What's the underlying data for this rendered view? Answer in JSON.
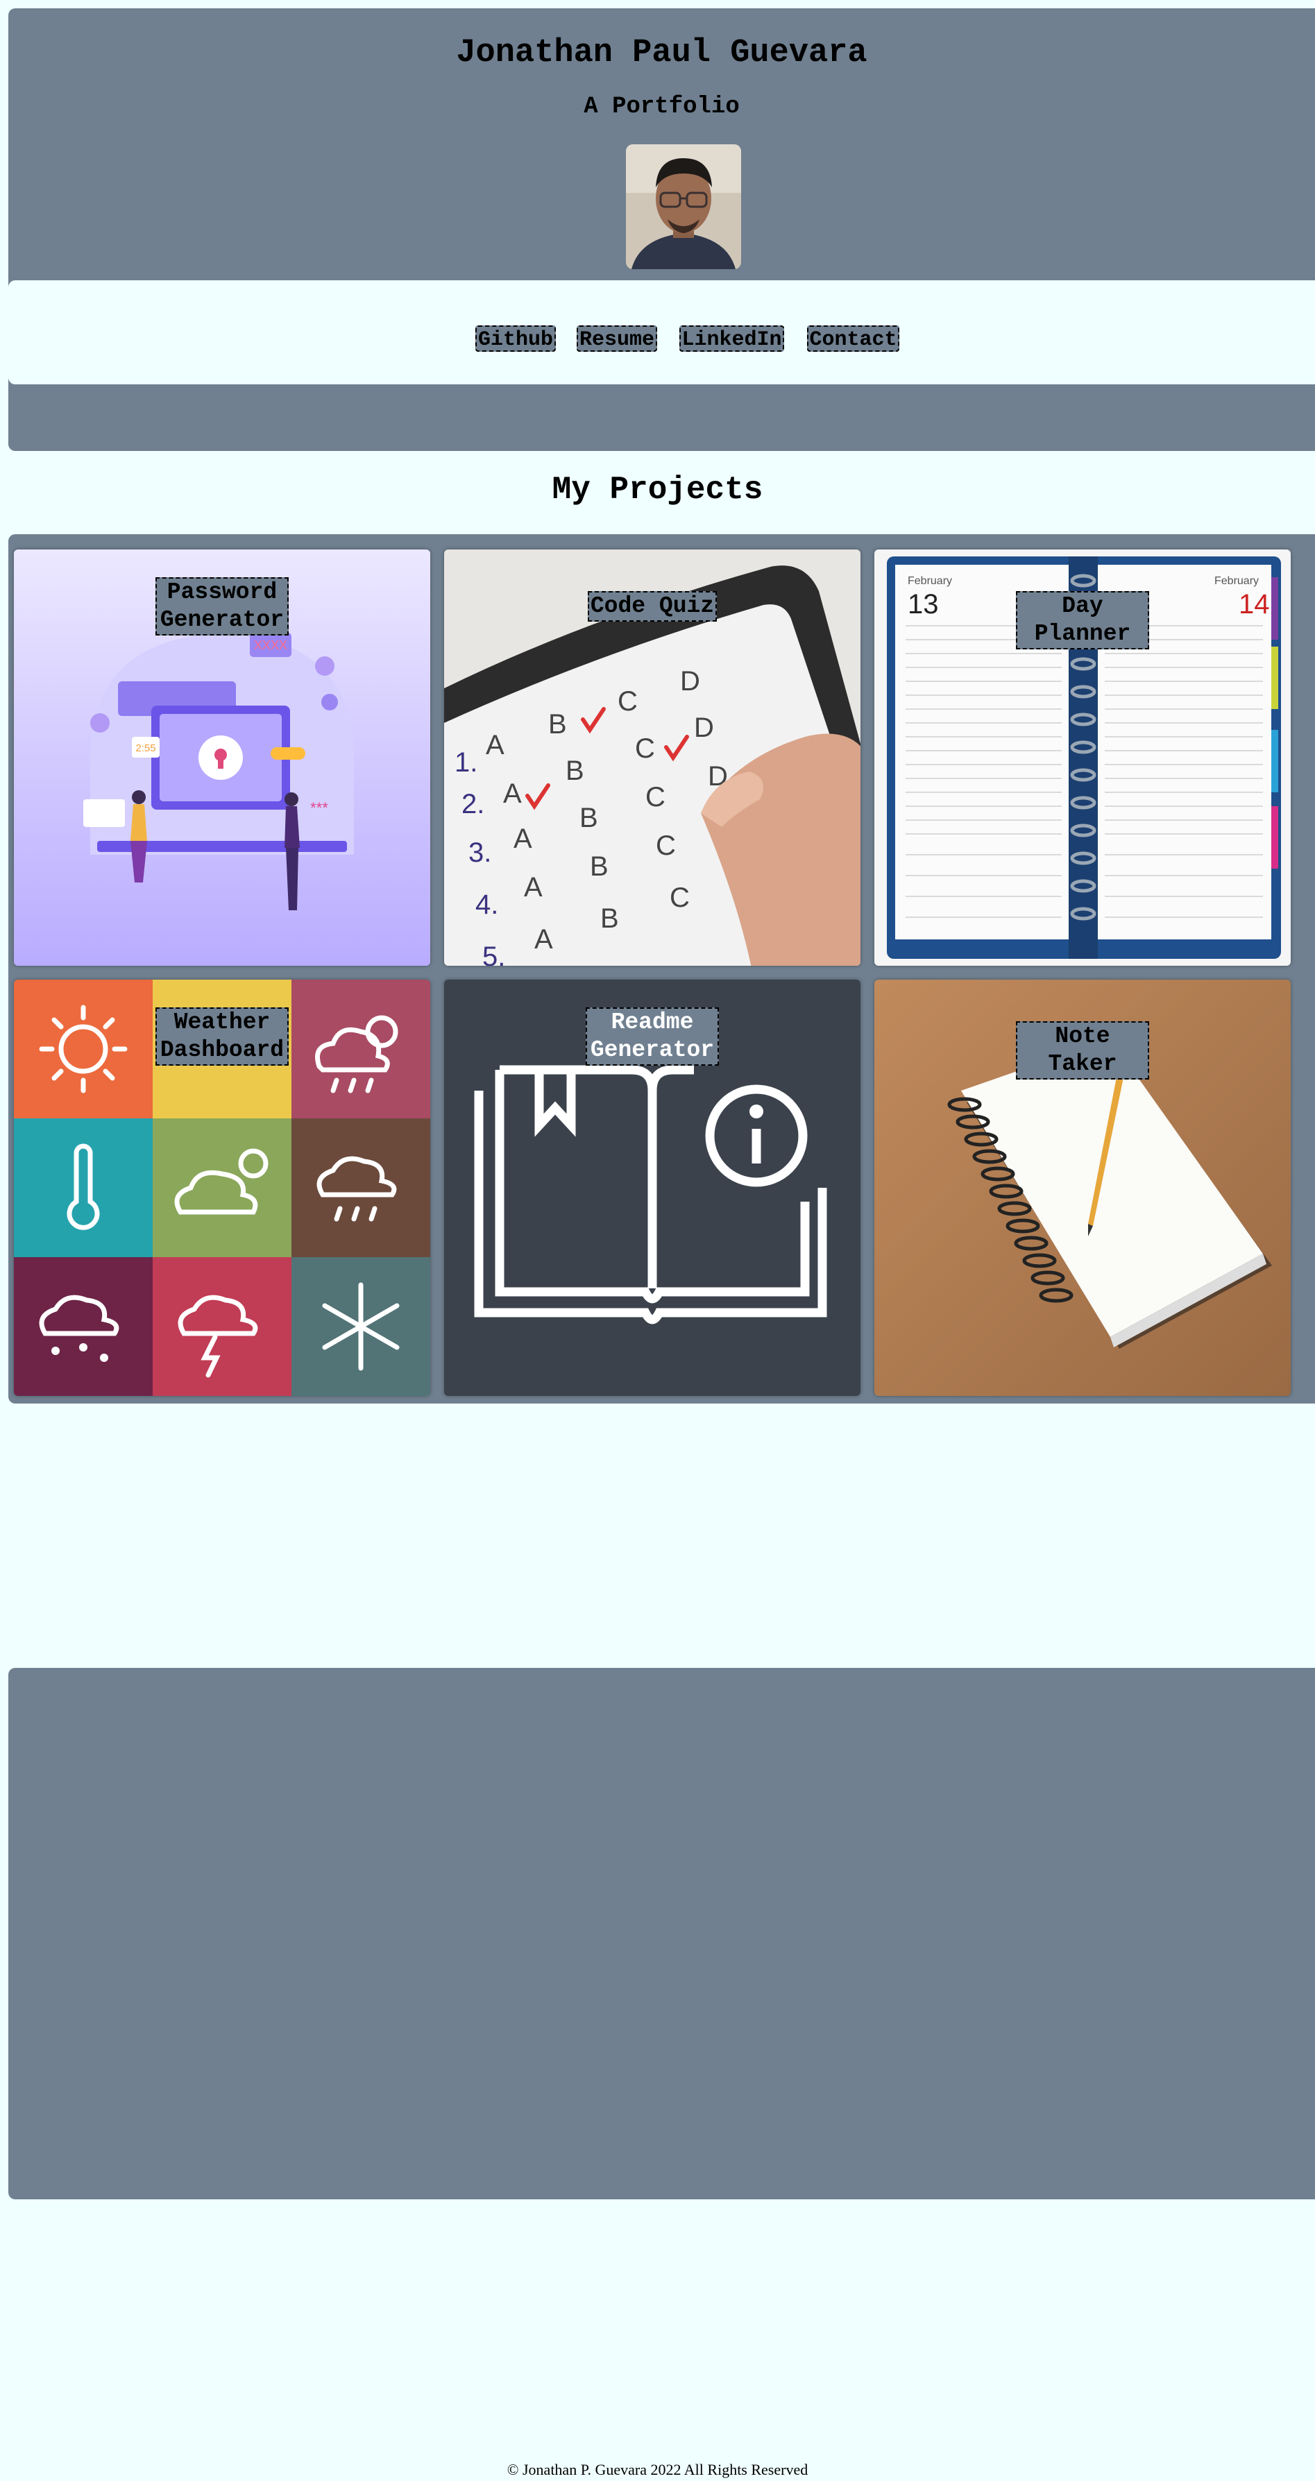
{
  "header": {
    "title": "Jonathan Paul Guevara",
    "subtitle": "A Portfolio"
  },
  "nav": {
    "links": [
      {
        "label": "Github"
      },
      {
        "label": "Resume"
      },
      {
        "label": "LinkedIn"
      },
      {
        "label": "Contact"
      }
    ]
  },
  "projects": {
    "heading": "My Projects",
    "cards": [
      {
        "title": "Password Generator",
        "image": "password-security-illustration"
      },
      {
        "title": "Code Quiz",
        "image": "quiz-answer-sheet-photo"
      },
      {
        "title": "Day Planner",
        "image": "daily-planner-photo"
      },
      {
        "title": "Weather Dashboard",
        "image": "weather-icon-grid"
      },
      {
        "title": "Readme Generator",
        "image": "book-info-icon"
      },
      {
        "title": "Note Taker",
        "image": "notebook-pencil-photo"
      }
    ]
  },
  "planner": {
    "left_month": "February",
    "left_day": "13",
    "right_month": "February",
    "right_day": "14"
  },
  "quiz": {
    "rows": [
      "1.",
      "2.",
      "3.",
      "4.",
      "5."
    ],
    "options": [
      "A",
      "B",
      "C",
      "D"
    ]
  },
  "password_art": {
    "timer": "2:55",
    "mask": "***",
    "code": "XXXX"
  },
  "footer": {
    "text": "© Jonathan P. Guevara 2022 All Rights Reserved"
  },
  "colors": {
    "page_bg": "#f0ffff",
    "panel_bg": "#708090",
    "readme_bg": "#3b424c"
  }
}
